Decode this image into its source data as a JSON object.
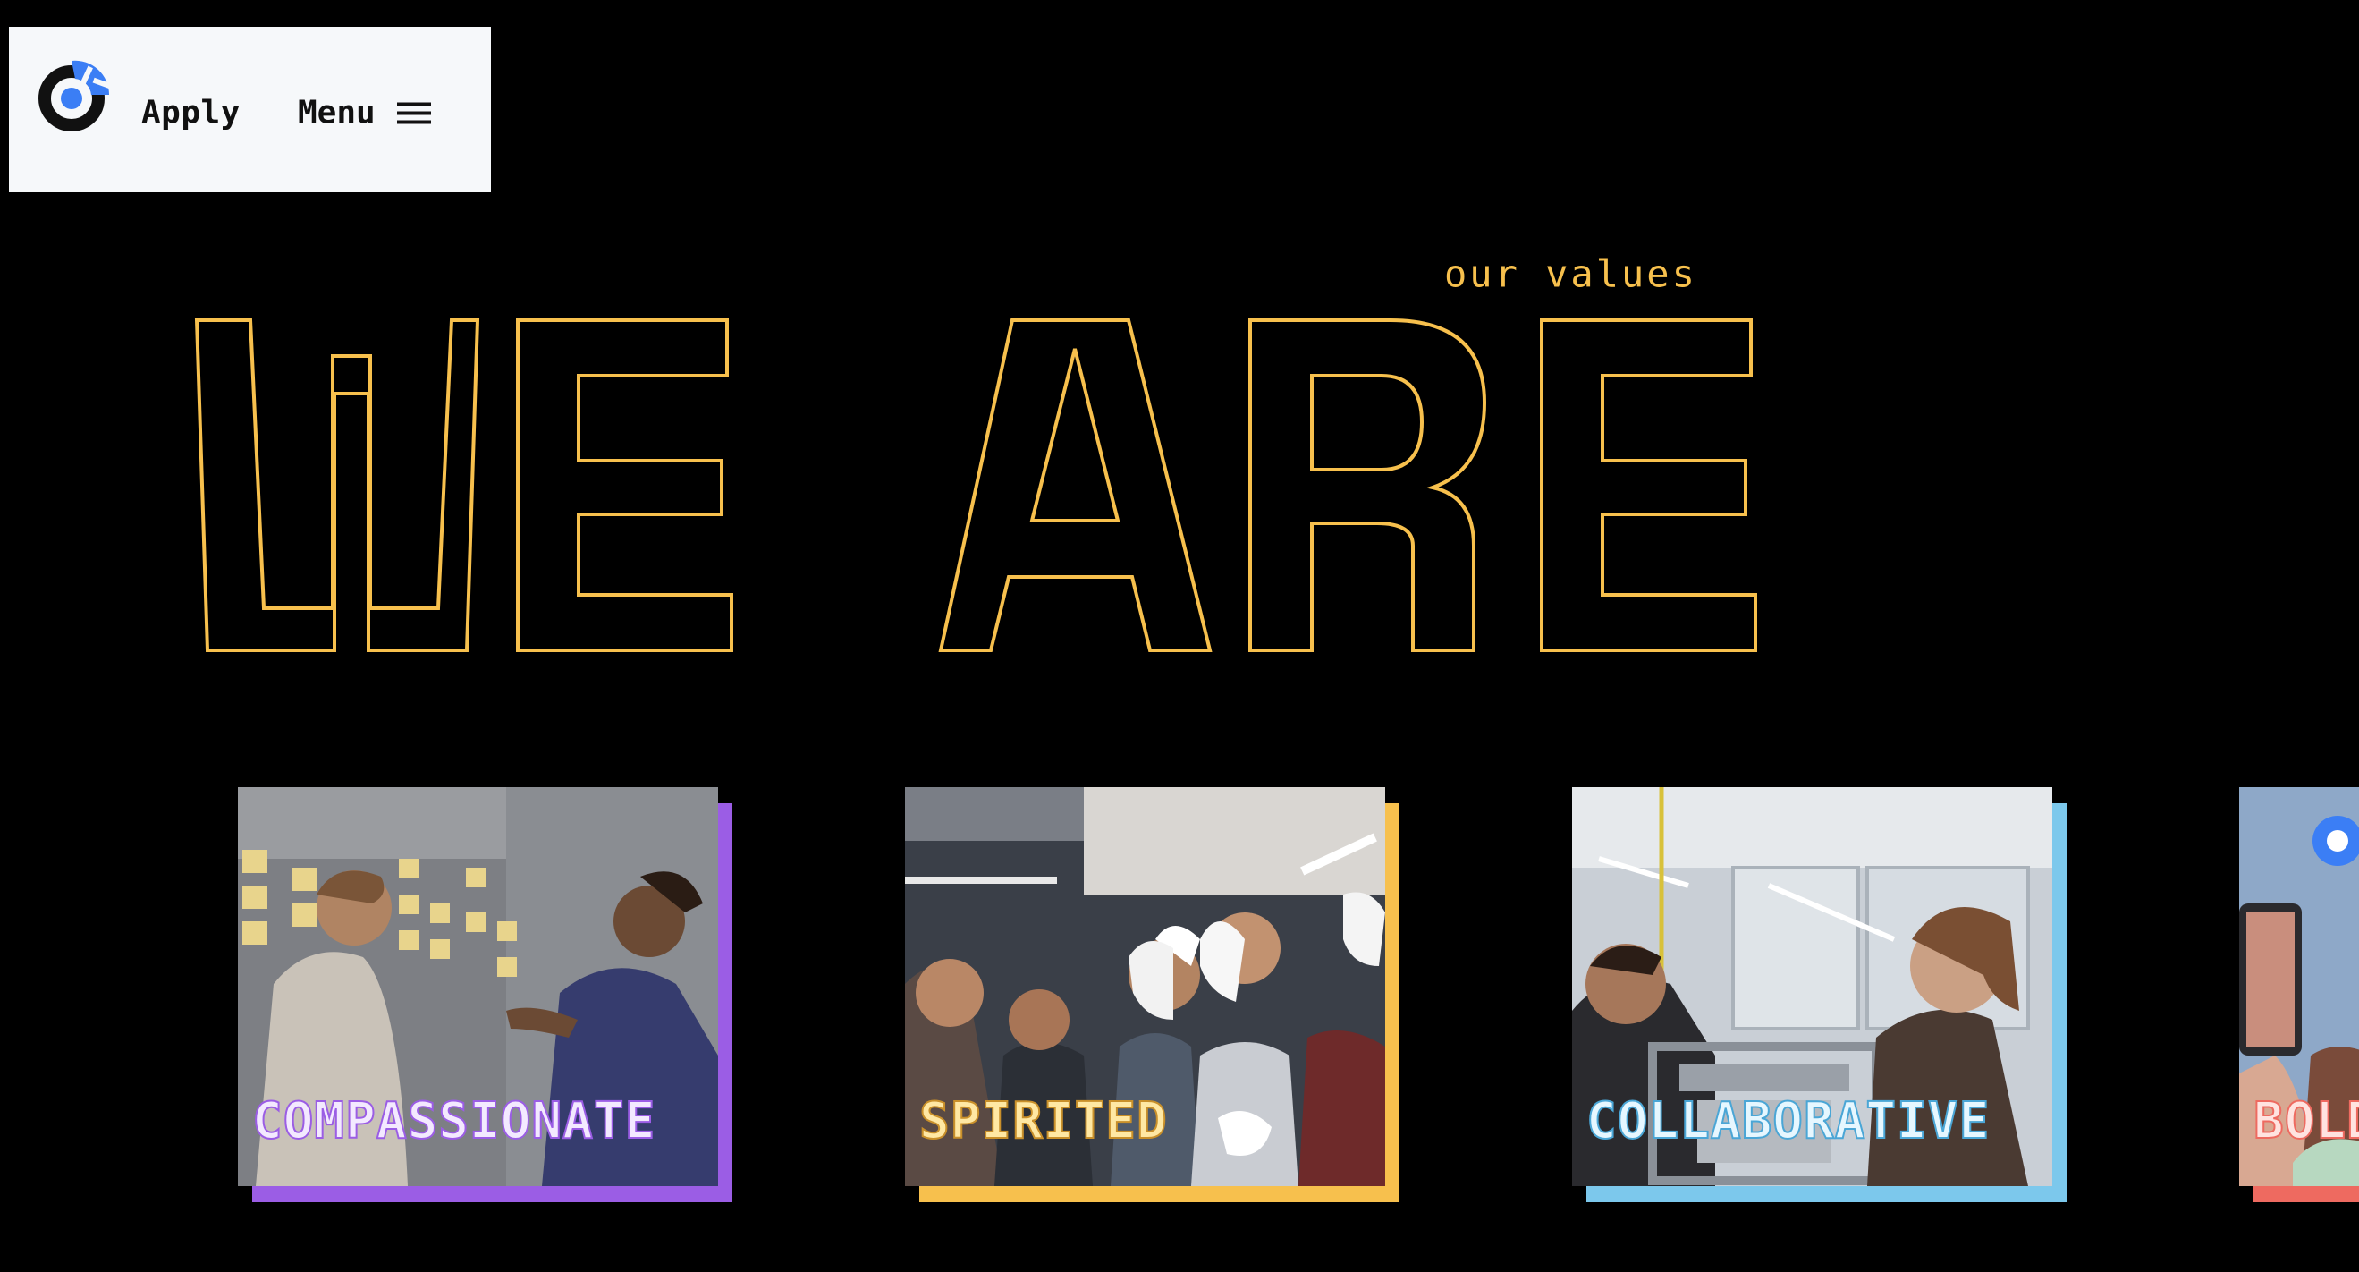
{
  "header": {
    "logo": {
      "icon": "circle-logo-icon",
      "color_dark": "#111111",
      "color_accent": "#3b7ef5"
    },
    "apply_label": "Apply",
    "menu_label": "Menu",
    "menu_icon": "hamburger-icon"
  },
  "hero": {
    "eyebrow": "our values",
    "headline": "WE ARE",
    "accent_color": "#f7c04d"
  },
  "values": [
    {
      "label": "COMPASSIONATE",
      "color": "#9b5de5",
      "image": "team-whiteboard-sticky-notes-photo"
    },
    {
      "label": "SPIRITED",
      "color": "#f7c04d",
      "image": "group-celebration-pie-photo"
    },
    {
      "label": "COLLABORATIVE",
      "color": "#7cc8ec",
      "image": "students-building-robot-photo"
    },
    {
      "label": "BOLD",
      "color": "#ee6a60",
      "image": "phone-camera-crowd-photo"
    }
  ]
}
